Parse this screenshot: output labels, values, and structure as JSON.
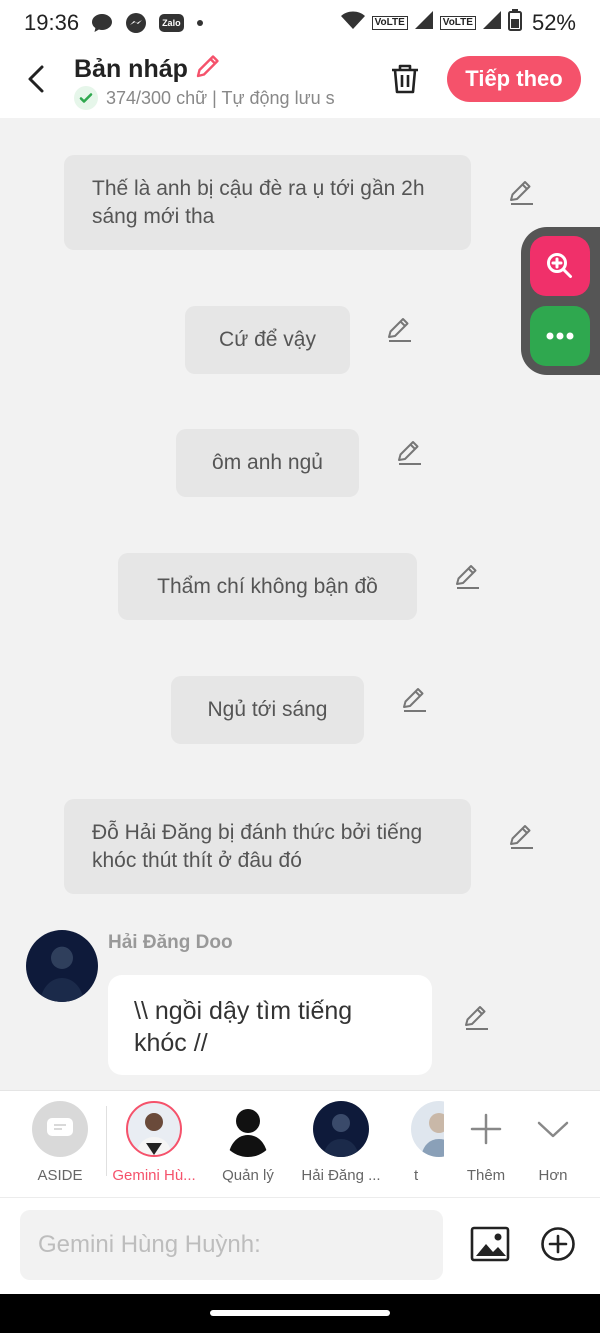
{
  "status_bar": {
    "time": "19:36",
    "zalo_label": "Zalo",
    "volte_1": "VoLTE",
    "volte_2": "VoLTE",
    "battery": "52%"
  },
  "header": {
    "title": "Bản nháp",
    "subtitle": "374/300 chữ | Tự động lưu s",
    "next_label": "Tiếp theo"
  },
  "messages": [
    {
      "text": "Thế là anh bị cậu đè ra ụ tới gần 2h sáng mới tha"
    },
    {
      "text": "Cứ để vậy"
    },
    {
      "text": "ôm anh ngủ"
    },
    {
      "text": "Thẩm chí không bận đồ"
    },
    {
      "text": "Ngủ tới sáng"
    },
    {
      "text": "Đỗ Hải Đăng bị đánh thức bởi tiếng khóc thút thít ở đâu đó"
    }
  ],
  "chat": {
    "sender": "Hải Đăng Doo",
    "text": "\\\\ ngồi dậy tìm tiếng khóc //"
  },
  "characters": [
    {
      "label": "ASIDE"
    },
    {
      "label": "Gemini Hù..."
    },
    {
      "label": "Quản lý"
    },
    {
      "label": "Hải Đăng ..."
    },
    {
      "label": "t"
    },
    {
      "label": "Thêm"
    },
    {
      "label": "Hơn"
    }
  ],
  "input": {
    "placeholder": "Gemini Hùng Huỳnh:"
  },
  "colors": {
    "accent": "#f5526b",
    "zoom_button": "#f0306a",
    "more_button": "#2fa84f"
  }
}
